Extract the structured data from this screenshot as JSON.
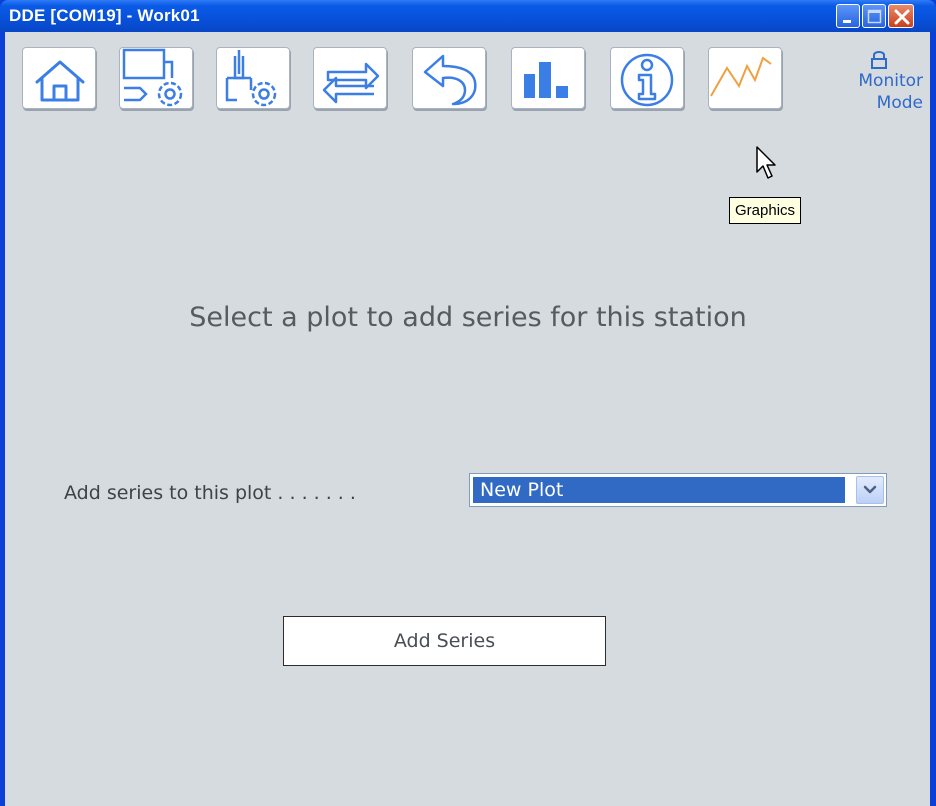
{
  "window": {
    "title": "DDE [COM19] - Work01"
  },
  "toolbar": {
    "buttons": [
      {
        "name": "home",
        "icon": "home-icon"
      },
      {
        "name": "device-settings",
        "icon": "device-gear-icon"
      },
      {
        "name": "instrument-settings",
        "icon": "instrument-gear-icon"
      },
      {
        "name": "transfer",
        "icon": "exchange-arrows-icon"
      },
      {
        "name": "undo",
        "icon": "undo-arrow-icon"
      },
      {
        "name": "statistics",
        "icon": "bar-chart-icon"
      },
      {
        "name": "info",
        "icon": "info-icon"
      },
      {
        "name": "graphics",
        "icon": "line-graph-icon"
      }
    ],
    "monitor_mode": {
      "line1": "Monitor",
      "line2": "Mode",
      "icon": "lock-icon"
    },
    "tooltip": "Graphics"
  },
  "main": {
    "heading": "Select a plot to add series for this station",
    "plot_field_label": "Add series to this plot . . . . . . .",
    "plot_select_value": "New Plot",
    "add_series_label": "Add Series"
  },
  "colors": {
    "accent": "#316ac5",
    "icon_blue": "#3b7fe6",
    "graphics_orange": "#f0a040",
    "background": "#d6dbe0"
  }
}
